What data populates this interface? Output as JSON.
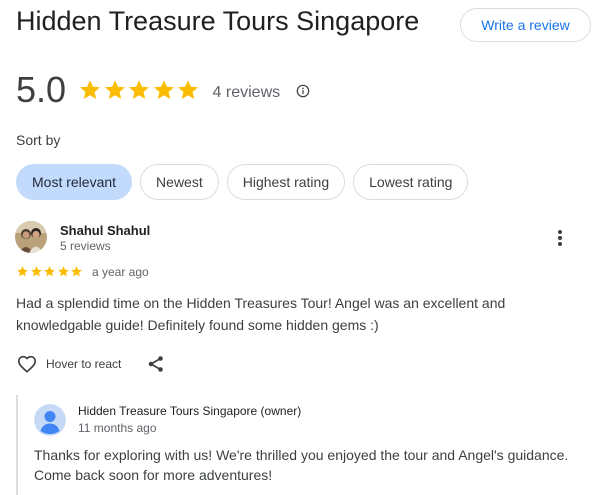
{
  "header": {
    "title": "Hidden Treasure Tours Singapore",
    "write_review_label": "Write a review"
  },
  "summary": {
    "rating": "5.0",
    "stars": 5,
    "review_count_label": "4 reviews"
  },
  "sort": {
    "label": "Sort by",
    "options": [
      "Most relevant",
      "Newest",
      "Highest rating",
      "Lowest rating"
    ],
    "selected": "Most relevant"
  },
  "reviews": [
    {
      "author": "Shahul Shahul",
      "author_reviews": "5 reviews",
      "stars": 5,
      "date": "a year ago",
      "text": "Had a splendid time on the Hidden Treasures Tour! Angel was an excellent and knowledgable guide! Definitely found some hidden gems :)",
      "react_label": "Hover to react",
      "owner_reply": {
        "author": "Hidden Treasure Tours Singapore (owner)",
        "date": "11 months ago",
        "text": "Thanks for exploring with us! We're thrilled you enjoyed the tour and Angel's guidance. Come back soon for more adventures!"
      }
    }
  ],
  "colors": {
    "star": "#fbbc04",
    "accent": "#1a73e8",
    "active_chip": "#c2dbfc",
    "divider": "#dadce0"
  },
  "icons": [
    "star-icon",
    "info-icon",
    "more-vert-icon",
    "heart-icon",
    "share-icon",
    "person-icon"
  ]
}
